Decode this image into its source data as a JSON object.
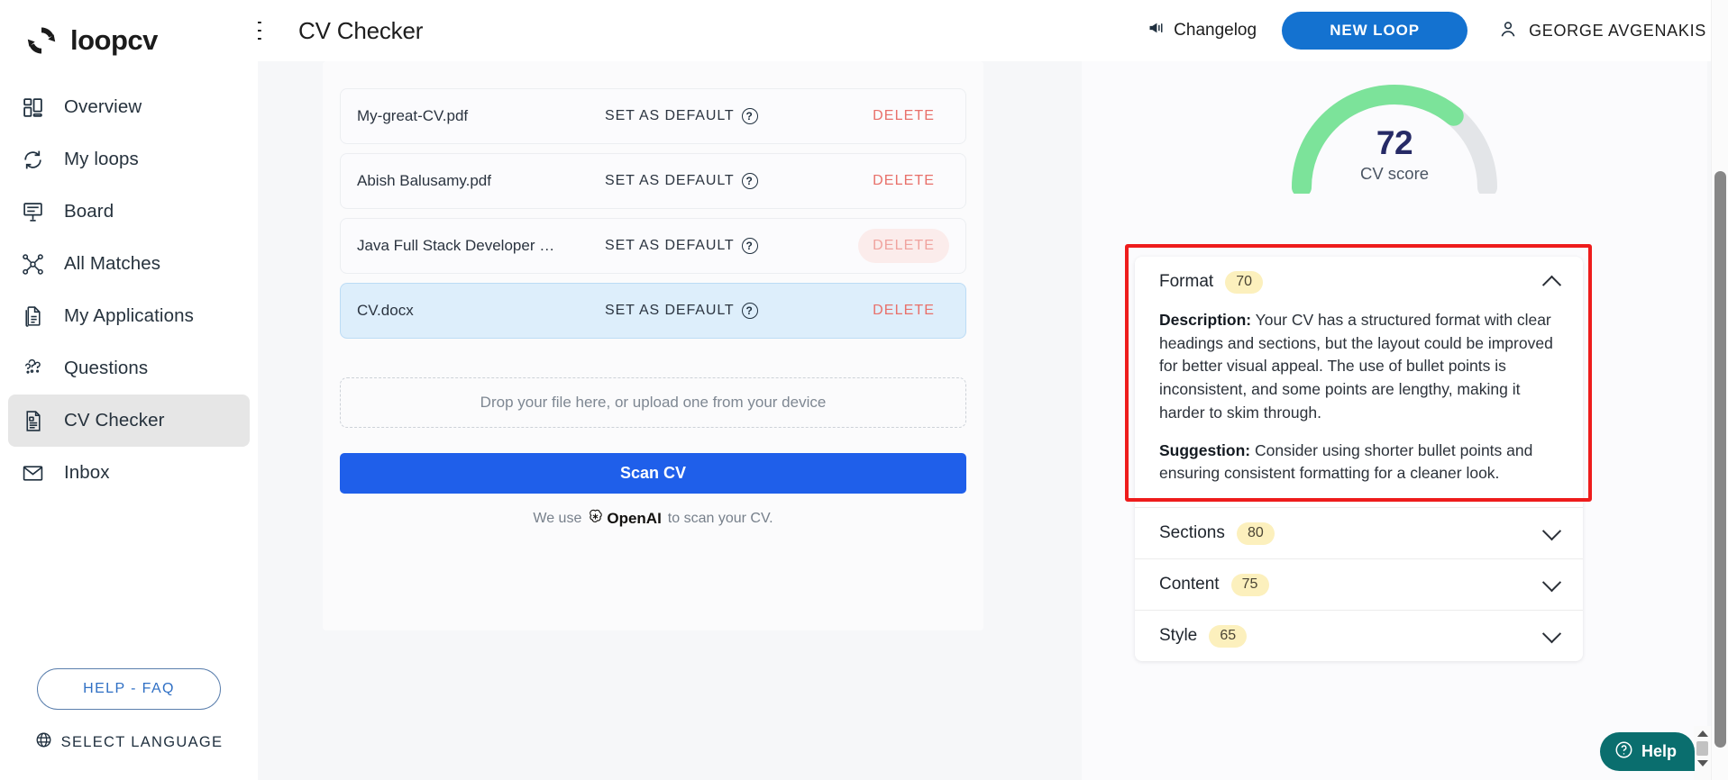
{
  "brand": {
    "name": "loopcv"
  },
  "sidebar": {
    "items": [
      {
        "label": "Overview",
        "icon": "dashboard-icon",
        "active": false
      },
      {
        "label": "My loops",
        "icon": "refresh-loop-icon",
        "active": false
      },
      {
        "label": "Board",
        "icon": "board-icon",
        "active": false
      },
      {
        "label": "All Matches",
        "icon": "network-icon",
        "active": false
      },
      {
        "label": "My Applications",
        "icon": "documents-icon",
        "active": false
      },
      {
        "label": "Questions",
        "icon": "questions-icon",
        "active": false
      },
      {
        "label": "CV Checker",
        "icon": "cv-document-icon",
        "active": true
      },
      {
        "label": "Inbox",
        "icon": "envelope-icon",
        "active": false
      }
    ],
    "help_faq_label": "HELP - FAQ",
    "select_language_label": "SELECT LANGUAGE"
  },
  "topbar": {
    "page_title": "CV Checker",
    "changelog_label": "Changelog",
    "new_loop_label": "NEW LOOP",
    "user_name": "GEORGE AVGENAKIS"
  },
  "cv_checker": {
    "files": [
      {
        "name": "My-great-CV.pdf",
        "set_default_label": "SET AS DEFAULT",
        "delete_label": "DELETE",
        "selected": false,
        "delete_hovered": false
      },
      {
        "name": "Abish Balusamy.pdf",
        "set_default_label": "SET AS DEFAULT",
        "delete_label": "DELETE",
        "selected": false,
        "delete_hovered": false
      },
      {
        "name": "Java Full Stack Developer …",
        "set_default_label": "SET AS DEFAULT",
        "delete_label": "DELETE",
        "selected": false,
        "delete_hovered": true
      },
      {
        "name": "CV.docx",
        "set_default_label": "SET AS DEFAULT",
        "delete_label": "DELETE",
        "selected": true,
        "delete_hovered": false
      }
    ],
    "dropzone_label": "Drop your file here, or upload one from your device",
    "scan_button_label": "Scan CV",
    "openai_prefix": "We use",
    "openai_brand": "OpenAI",
    "openai_suffix": "to scan your CV."
  },
  "score_panel": {
    "score": "72",
    "score_label": "CV score",
    "score_percent": 72,
    "gauge_fill_color": "#7ce39a",
    "gauge_track_color": "#e3e5e8",
    "sections": [
      {
        "title": "Format",
        "badge": "70",
        "expanded": true,
        "highlighted": true,
        "description_label": "Description:",
        "description": " Your CV has a structured format with clear headings and sections, but the layout could be improved for better visual appeal. The use of bullet points is inconsistent, and some points are lengthy, making it harder to skim through.",
        "suggestion_label": "Suggestion:",
        "suggestion": " Consider using shorter bullet points and ensuring consistent formatting for a cleaner look."
      },
      {
        "title": "Sections",
        "badge": "80",
        "expanded": false,
        "highlighted": false
      },
      {
        "title": "Content",
        "badge": "75",
        "expanded": false,
        "highlighted": false
      },
      {
        "title": "Style",
        "badge": "65",
        "expanded": false,
        "highlighted": false
      }
    ]
  },
  "help_widget": {
    "label": "Help"
  },
  "colors": {
    "accent_blue": "#1472d0",
    "scan_blue": "#1f5fea",
    "delete_red": "#e8706a",
    "badge_yellow": "#fcf0bd",
    "annotation_red": "#ee1c1c",
    "help_teal": "#0a6e6e"
  }
}
